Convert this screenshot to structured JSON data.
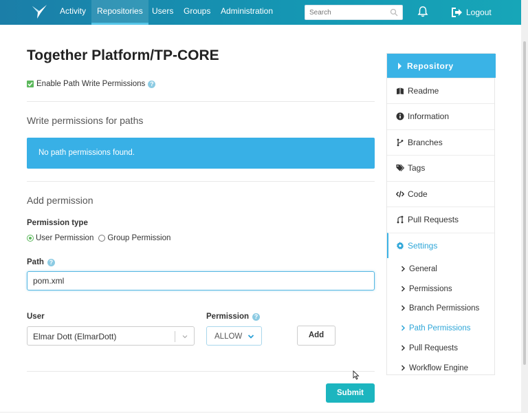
{
  "nav": {
    "items": [
      {
        "label": "Activity",
        "active": false
      },
      {
        "label": "Repositories",
        "active": true
      },
      {
        "label": "Users",
        "active": false
      },
      {
        "label": "Groups",
        "active": false
      },
      {
        "label": "Administration",
        "active": false
      }
    ],
    "search_placeholder": "Search",
    "logout_label": "Logout"
  },
  "page": {
    "title": "Together Platform/TP-CORE",
    "enable_checkbox_label": "Enable Path Write Permissions",
    "enable_checked": true,
    "write_section_title": "Write permissions for paths",
    "empty_message": "No path permissions found.",
    "add_section_title": "Add permission",
    "permission_type_label": "Permission type",
    "radio_user": "User Permission",
    "radio_group": "Group Permission",
    "path_label": "Path",
    "path_value": "pom.xml",
    "user_label": "User",
    "user_value": "Elmar Dott (ElmarDott)",
    "permission_label": "Permission",
    "permission_value": "ALLOW",
    "add_label": "Add",
    "submit_label": "Submit"
  },
  "sidebar": {
    "header": "Repository",
    "items": [
      {
        "label": "Readme",
        "icon": "book-icon"
      },
      {
        "label": "Information",
        "icon": "info-icon"
      },
      {
        "label": "Branches",
        "icon": "branch-icon"
      },
      {
        "label": "Tags",
        "icon": "tags-icon"
      },
      {
        "label": "Code",
        "icon": "code-icon"
      },
      {
        "label": "Pull Requests",
        "icon": "pull-request-icon"
      },
      {
        "label": "Settings",
        "icon": "gear-icon"
      }
    ],
    "sub_items": [
      {
        "label": "General"
      },
      {
        "label": "Permissions"
      },
      {
        "label": "Branch Permissions"
      },
      {
        "label": "Path Permissions"
      },
      {
        "label": "Pull Requests"
      },
      {
        "label": "Workflow Engine"
      }
    ]
  },
  "colors": {
    "accent": "#3ab3e6",
    "submit": "#1cb5bf",
    "checkbox": "#5cb85c"
  }
}
